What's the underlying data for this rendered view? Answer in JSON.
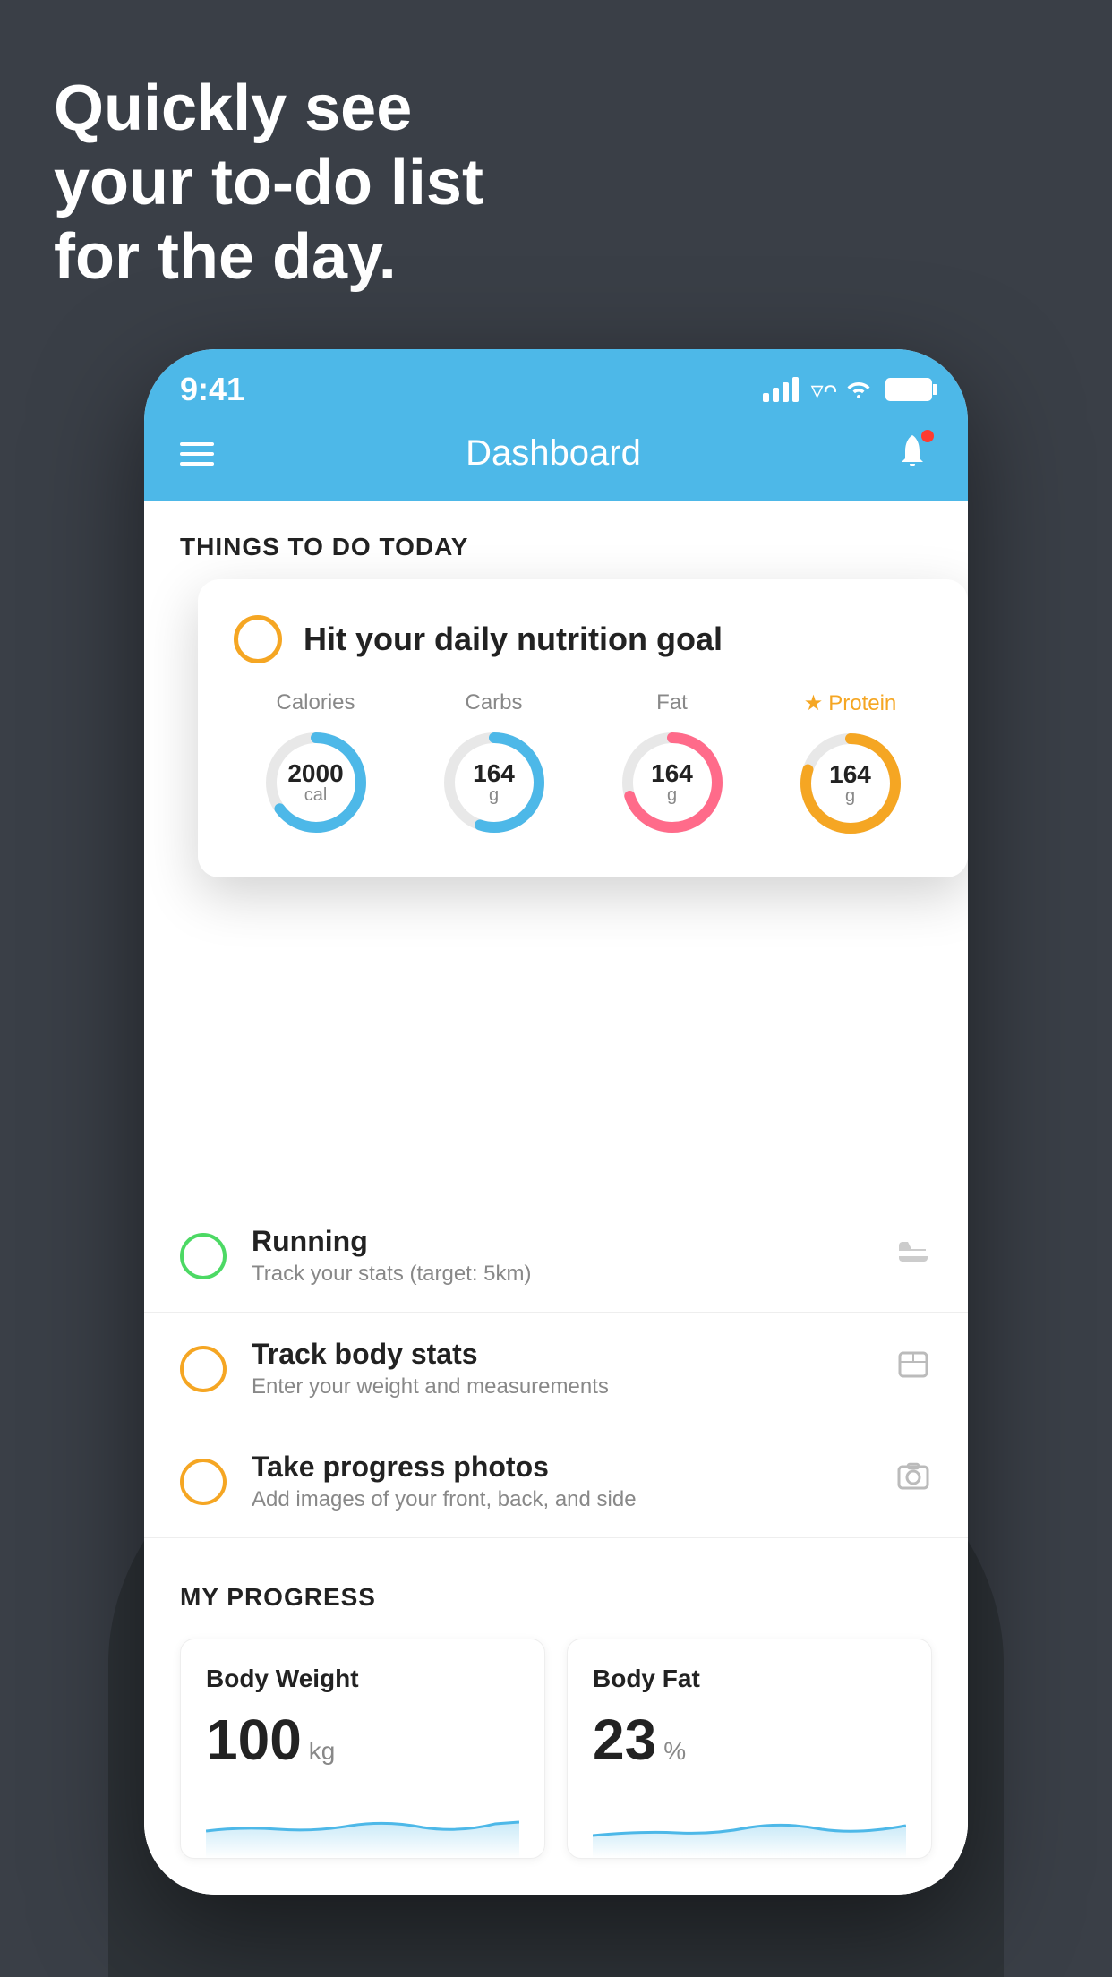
{
  "hero": {
    "line1": "Quickly see",
    "line2": "your to-do list",
    "line3": "for the day."
  },
  "status_bar": {
    "time": "9:41"
  },
  "nav": {
    "title": "Dashboard"
  },
  "things_section": {
    "header": "THINGS TO DO TODAY"
  },
  "floating_card": {
    "title": "Hit your daily nutrition goal",
    "nutrients": [
      {
        "label": "Calories",
        "value": "2000",
        "unit": "cal",
        "color": "#4db8e8",
        "pct": 65,
        "starred": false
      },
      {
        "label": "Carbs",
        "value": "164",
        "unit": "g",
        "color": "#4db8e8",
        "pct": 55,
        "starred": false
      },
      {
        "label": "Fat",
        "value": "164",
        "unit": "g",
        "color": "#ff6b8a",
        "pct": 70,
        "starred": false
      },
      {
        "label": "Protein",
        "value": "164",
        "unit": "g",
        "color": "#f5a623",
        "pct": 80,
        "starred": true
      }
    ]
  },
  "todo_items": [
    {
      "title": "Running",
      "subtitle": "Track your stats (target: 5km)",
      "circle_color": "green",
      "icon": "shoe"
    },
    {
      "title": "Track body stats",
      "subtitle": "Enter your weight and measurements",
      "circle_color": "yellow",
      "icon": "scale"
    },
    {
      "title": "Take progress photos",
      "subtitle": "Add images of your front, back, and side",
      "circle_color": "yellow",
      "icon": "photo"
    }
  ],
  "progress": {
    "section_title": "MY PROGRESS",
    "cards": [
      {
        "title": "Body Weight",
        "value": "100",
        "unit": "kg"
      },
      {
        "title": "Body Fat",
        "value": "23",
        "unit": "%"
      }
    ]
  }
}
